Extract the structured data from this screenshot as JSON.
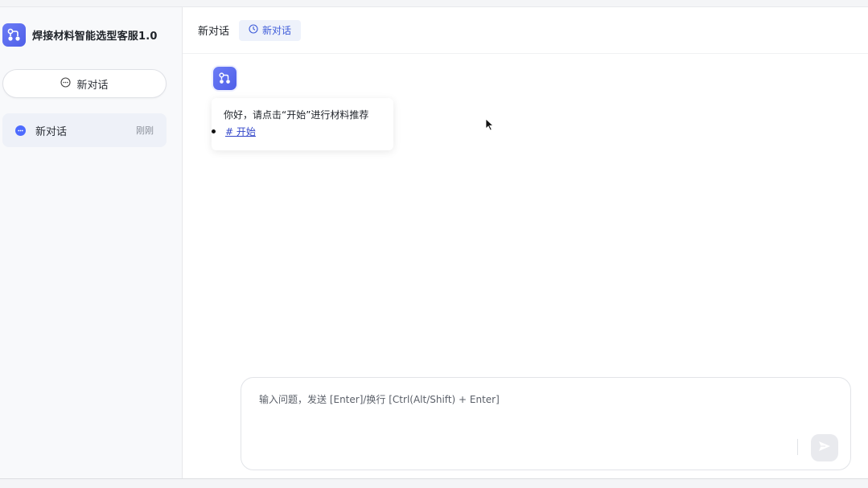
{
  "app": {
    "title": "焊接材料智能选型客服1.0"
  },
  "sidebar": {
    "new_chat_label": "新对话",
    "conversations": [
      {
        "label": "新对话",
        "time": "刚刚",
        "active": true
      }
    ]
  },
  "header": {
    "title": "新对话",
    "tag_label": "新对话"
  },
  "chat": {
    "messages": [
      {
        "role": "assistant",
        "text": "你好，请点击“开始”进行材料推荐",
        "links": [
          "# 开始"
        ]
      }
    ]
  },
  "composer": {
    "placeholder": "输入问题，发送 [Enter]/换行 [Ctrl(Alt/Shift) + Enter]",
    "value": ""
  },
  "colors": {
    "accent": "#4d6bfe",
    "brand_gradient_start": "#6b7cf6",
    "brand_gradient_end": "#4f5fe8",
    "link": "#3346c9"
  },
  "icons": {
    "brand": "flow-nodes-icon",
    "new_chat": "chat-bubble-icon",
    "conversation": "chat-dot-icon",
    "tag": "clock-icon",
    "send": "send-icon"
  }
}
